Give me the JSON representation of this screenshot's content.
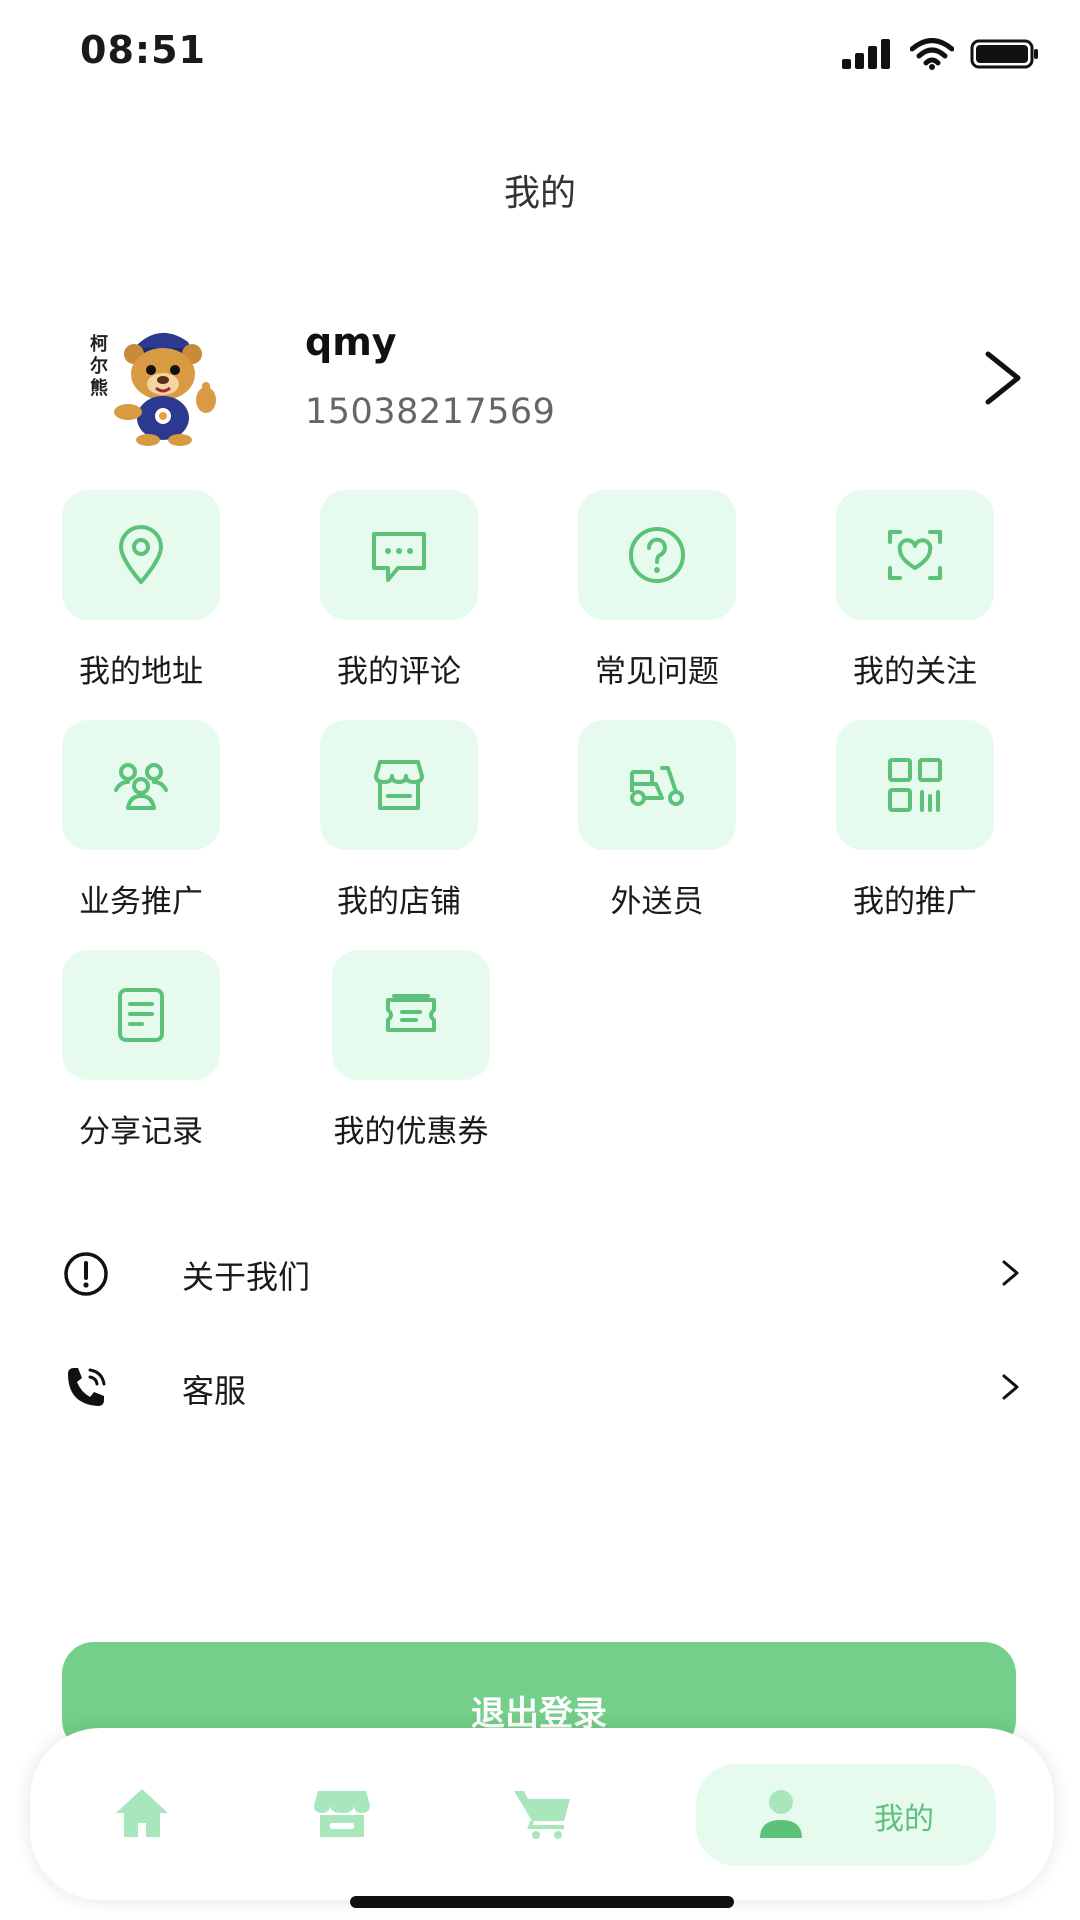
{
  "status_bar": {
    "time": "08:51",
    "icons": [
      "signal-icon",
      "wifi-icon",
      "battery-icon"
    ]
  },
  "header": {
    "title": "我的"
  },
  "profile": {
    "username": "qmy",
    "phone": "15038217569",
    "avatar_icon": "bear-mascot-avatar",
    "avatar_logo_text": "柯尔熊"
  },
  "grid": {
    "items": [
      {
        "label": "我的地址",
        "icon": "location-pin-icon"
      },
      {
        "label": "我的评论",
        "icon": "chat-bubble-icon"
      },
      {
        "label": "常见问题",
        "icon": "question-circle-icon"
      },
      {
        "label": "我的关注",
        "icon": "heart-focus-icon"
      },
      {
        "label": "业务推广",
        "icon": "group-users-icon"
      },
      {
        "label": "我的店铺",
        "icon": "store-icon"
      },
      {
        "label": "外送员",
        "icon": "scooter-icon"
      },
      {
        "label": "我的推广",
        "icon": "qr-code-icon"
      },
      {
        "label": "分享记录",
        "icon": "document-icon"
      },
      {
        "label": "我的优惠券",
        "icon": "coupon-icon"
      }
    ]
  },
  "list": {
    "items": [
      {
        "label": "关于我们",
        "icon": "info-circle-icon"
      },
      {
        "label": "客服",
        "icon": "phone-call-icon"
      }
    ]
  },
  "logout": {
    "label": "退出登录"
  },
  "tabbar": {
    "tabs": [
      {
        "icon": "home-icon"
      },
      {
        "icon": "shop-icon"
      },
      {
        "icon": "cart-icon"
      },
      {
        "icon": "user-icon",
        "label": "我的",
        "active": true
      }
    ]
  },
  "colors": {
    "accent": "#74cf8a",
    "tile_bg": "#e6fbee",
    "icon_green": "#5cc27a"
  }
}
